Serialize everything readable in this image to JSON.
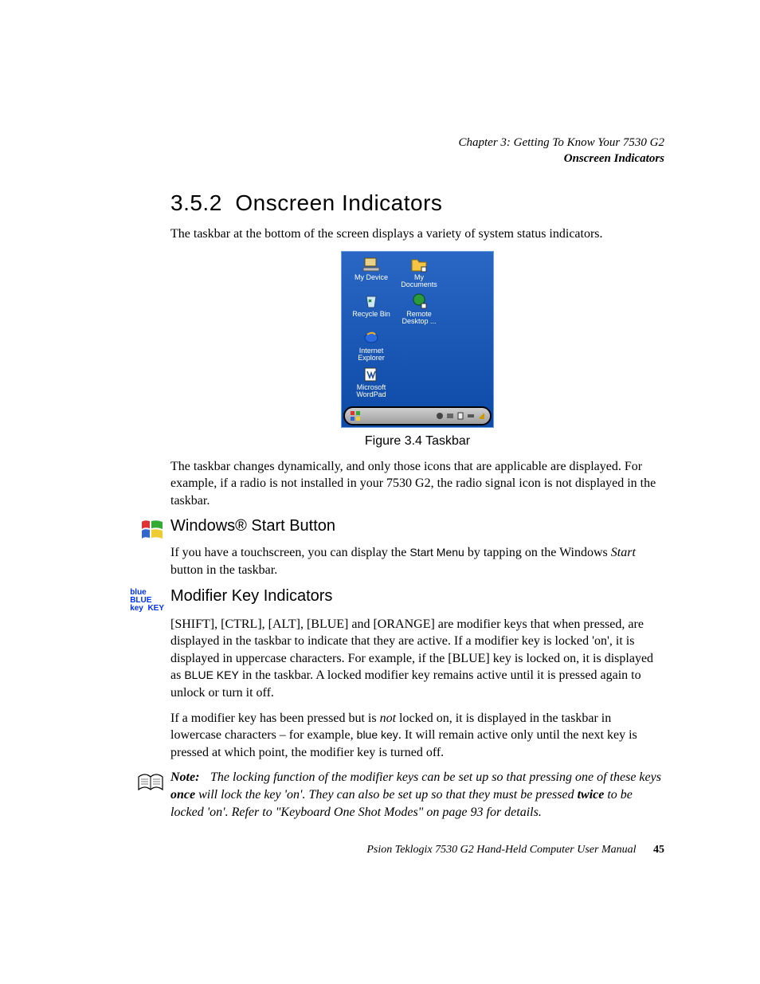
{
  "header": {
    "chapter": "Chapter  3:  Getting To Know Your 7530 G2",
    "section": "Onscreen Indicators"
  },
  "section": {
    "number": "3.5.2",
    "title": "Onscreen Indicators",
    "intro": "The taskbar at the bottom of the screen displays a variety of system status indicators."
  },
  "figure": {
    "caption": "Figure 3.4 Taskbar",
    "desktop_icons": {
      "my_device": "My Device",
      "my_documents": "My Documents",
      "recycle_bin": "Recycle Bin",
      "remote_desktop": "Remote Desktop ...",
      "internet_explorer": "Internet Explorer",
      "wordpad": "Microsoft WordPad"
    }
  },
  "para1": "The taskbar changes dynamically, and only those icons that are applicable are displayed. For example, if a radio is not installed in your 7530 G2, the radio signal icon is not displayed in the taskbar.",
  "windows": {
    "heading": "Windows® Start Button",
    "text_a": "If you have a touchscreen, you can display the ",
    "start_menu": "Start Menu",
    "text_b": " by tapping on the Windows ",
    "start_ital": "Start",
    "text_c": " button in the taskbar."
  },
  "modifier": {
    "icon_lines": {
      "l1a": "blue",
      "l1b": "BLUE",
      "l2a": "key",
      "l2b": "KEY"
    },
    "heading": "Modifier Key Indicators",
    "p1a": "[SHIFT], [CTRL], [ALT], [BLUE] and [ORANGE] are modifier keys that when pressed, are displayed in the taskbar to indicate that they are active. If a modifier key is locked 'on', it is displayed in uppercase characters. For example, if the [BLUE] key is locked on, it is displayed as ",
    "blue_key_upper": "BLUE KEY",
    "p1b": " in the taskbar. A locked modifier key remains active until it is pressed again to unlock or turn it off.",
    "p2a": "If a modifier key has been pressed but is ",
    "not_ital": "not",
    "p2b": " locked on, it is displayed in the taskbar in lowercase characters – for example, ",
    "blue_key_lower": "blue key",
    "p2c": ". It will remain active only until the next key is pressed at which point, the modifier key is turned off."
  },
  "note": {
    "label": "Note:",
    "t1": "The locking function of the modifier keys can be set up so that pressing one of these keys ",
    "once": "once",
    "t2": " will lock the key 'on'. They can also be set up so that they must be pressed ",
    "twice": "twice",
    "t3": " to be locked 'on'. Refer to \"Keyboard One Shot Modes\" on page 93 for details."
  },
  "footer": {
    "text": "Psion Teklogix 7530 G2 Hand-Held Computer User Manual",
    "page": "45"
  }
}
